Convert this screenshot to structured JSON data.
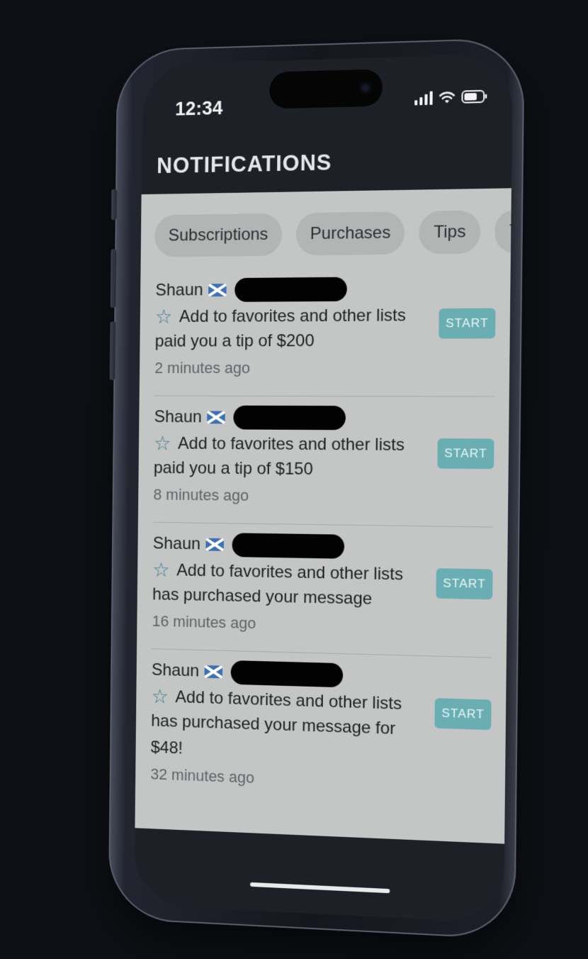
{
  "status": {
    "time": "12:34",
    "icons": [
      "signal-icon",
      "wifi-icon",
      "battery-icon"
    ]
  },
  "header": {
    "title": "NOTIFICATIONS"
  },
  "tabs": [
    "Subscriptions",
    "Purchases",
    "Tips",
    "T"
  ],
  "notifications": [
    {
      "name": "Shaun",
      "favorite_label": "Add to favorites and other lists",
      "message": "paid you a tip of $200",
      "time": "2 minutes ago",
      "action": "START"
    },
    {
      "name": "Shaun",
      "favorite_label": "Add to favorites and other lists",
      "message": "paid you a tip of $150",
      "time": "8 minutes ago",
      "action": "START"
    },
    {
      "name": "Shaun",
      "favorite_label": "Add to favorites and other lists",
      "message": "has purchased your message",
      "time": "16 minutes ago",
      "action": "START"
    },
    {
      "name": "Shaun",
      "favorite_label": "Add to favorites and other lists",
      "message": "has purchased your message for $48!",
      "time": "32 minutes ago",
      "action": "START"
    }
  ],
  "colors": {
    "accent": "#6aaeb4",
    "panel": "#c4c5c5",
    "screen": "#1d2127",
    "star": "#3e7d93"
  }
}
